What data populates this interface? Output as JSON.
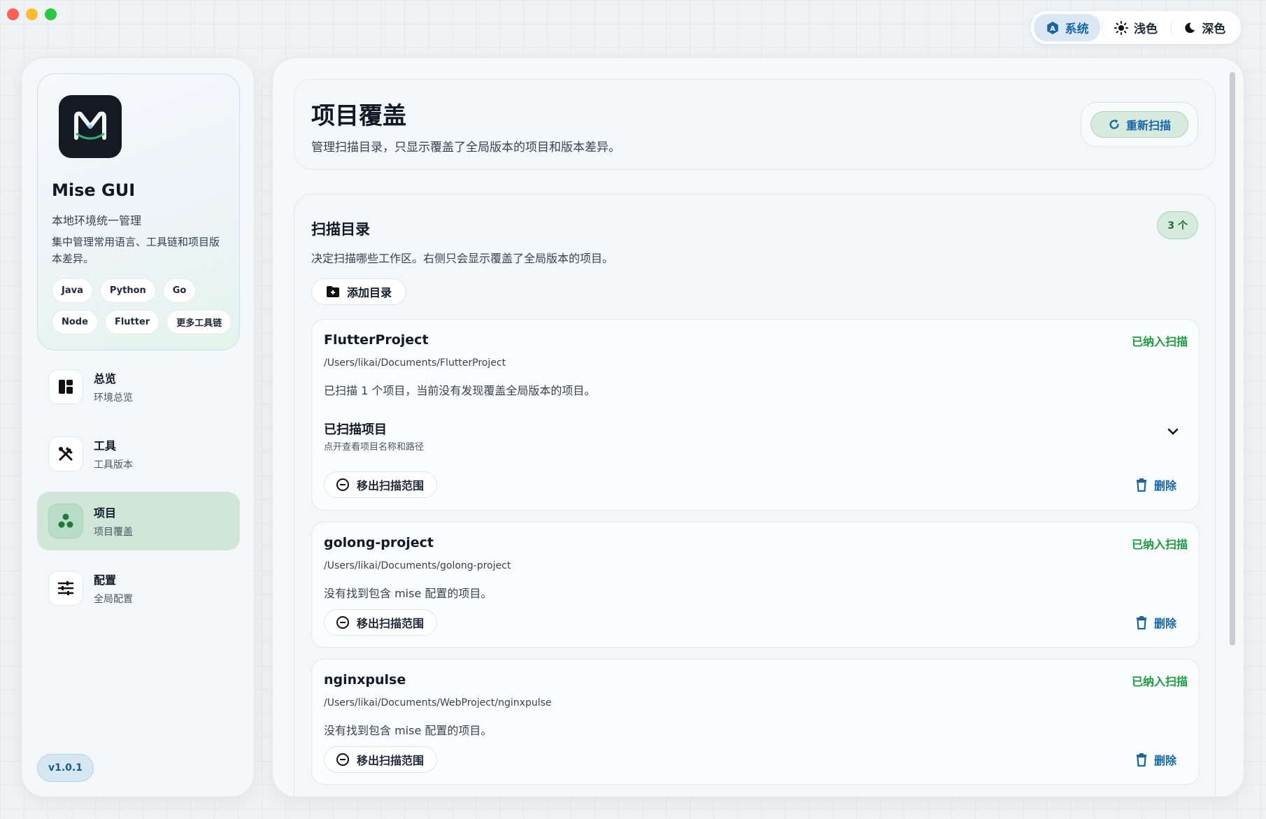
{
  "theme": {
    "options": [
      {
        "label": "系统",
        "icon": "system-theme-icon"
      },
      {
        "label": "浅色",
        "icon": "sun-icon"
      },
      {
        "label": "深色",
        "icon": "moon-icon"
      }
    ],
    "selected": "系统"
  },
  "sidebar": {
    "app_name": "Mise GUI",
    "subtitle": "本地环境统一管理",
    "description": "集中管理常用语言、工具链和项目版本差异。",
    "chips": [
      "Java",
      "Python",
      "Go",
      "Node",
      "Flutter",
      "更多工具链"
    ],
    "nav": [
      {
        "title": "总览",
        "sub": "环境总览",
        "icon": "dashboard-icon"
      },
      {
        "title": "工具",
        "sub": "工具版本",
        "icon": "tools-icon"
      },
      {
        "title": "项目",
        "sub": "项目覆盖",
        "icon": "projects-icon",
        "active": true
      },
      {
        "title": "配置",
        "sub": "全局配置",
        "icon": "sliders-icon"
      }
    ],
    "version": "v1.0.1"
  },
  "header": {
    "title": "项目覆盖",
    "description": "管理扫描目录，只显示覆盖了全局版本的项目和版本差异。",
    "rescan_label": "重新扫描"
  },
  "scan": {
    "title": "扫描目录",
    "description": "决定扫描哪些工作区。右侧只会显示覆盖了全局版本的项目。",
    "count": "3 个",
    "add_label": "添加目录",
    "dirs": [
      {
        "name": "FlutterProject",
        "status": "已纳入扫描",
        "path": "/Users/likai/Documents/FlutterProject",
        "info": "已扫描 1 个项目，当前没有发现覆盖全局版本的项目。",
        "scanned_title": "已扫描项目",
        "scanned_sub": "点开查看项目名称和路径",
        "remove_label": "移出扫描范围",
        "delete_label": "删除"
      },
      {
        "name": "golong-project",
        "status": "已纳入扫描",
        "path": "/Users/likai/Documents/golong-project",
        "info": "没有找到包含 mise 配置的项目。",
        "remove_label": "移出扫描范围",
        "delete_label": "删除"
      },
      {
        "name": "nginxpulse",
        "status": "已纳入扫描",
        "path": "/Users/likai/Documents/WebProject/nginxpulse",
        "info": "没有找到包含 mise 配置的项目。",
        "remove_label": "移出扫描范围",
        "delete_label": "删除"
      }
    ]
  },
  "colors": {
    "accent_green": "#1c9a3e",
    "accent_blue": "#1565a8",
    "active_nav": "#cfe6d8"
  }
}
